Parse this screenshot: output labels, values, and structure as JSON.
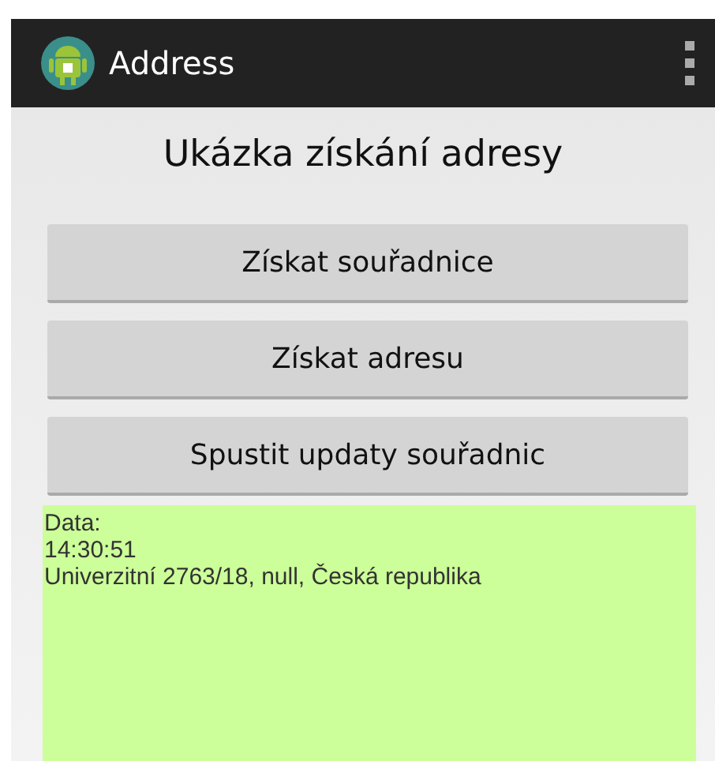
{
  "action_bar": {
    "title": "Address"
  },
  "heading": "Ukázka získání adresy",
  "buttons": [
    "Získat souřadnice",
    "Získat adresu",
    "Spustit updaty souřadnic"
  ],
  "output": {
    "lines": [
      "Data:",
      "14:30:51",
      "Univerzitní 2763/18, null, Česká republika"
    ]
  }
}
